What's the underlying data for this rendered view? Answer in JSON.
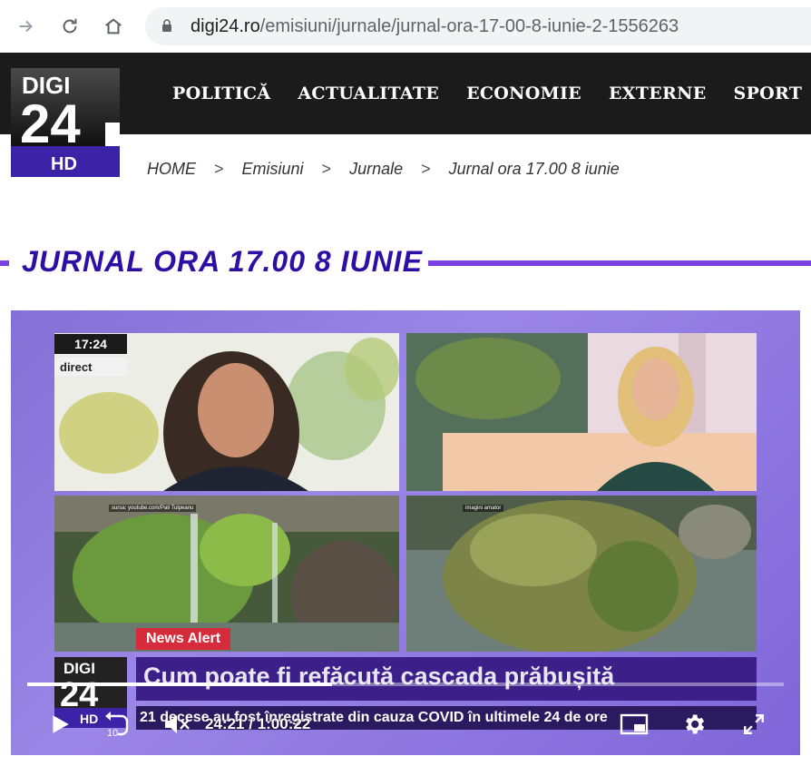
{
  "browser": {
    "url_domain": "digi24.ro",
    "url_path": "/emisiuni/jurnale/jurnal-ora-17-00-8-iunie-2-1556263"
  },
  "site": {
    "logo_top": "DIGI",
    "logo_num": "24",
    "logo_badge": "HD",
    "nav": [
      "POLITICĂ",
      "ACTUALITATE",
      "ECONOMIE",
      "EXTERNE",
      "SPORT"
    ]
  },
  "breadcrumb": {
    "items": [
      "HOME",
      "Emisiuni",
      "Jurnale",
      "Jurnal ora 17.00 8 iunie"
    ],
    "separator": ">"
  },
  "page_title": "JURNAL ORA 17.00 8 IUNIE",
  "video": {
    "clock": "17:24",
    "live_label": "direct",
    "source_1": "sursa: youtube.com/Pali Tulpeanu",
    "source_2": "imagini amator",
    "news_alert": "News Alert",
    "headline": "Cum poate fi refăcută cascada prăbușită",
    "ticker": "21 decese au fost înregistrate din cauza COVID în ultimele 24 de ore",
    "logo_top": "DIGI",
    "logo_num": "24",
    "logo_badge": "HD",
    "current_time": "24:21",
    "time_sep": "/",
    "duration": "1:00:22",
    "progress": 0.403,
    "skip_seconds": "10"
  },
  "colors": {
    "header_bg": "#1b1b1b",
    "title": "#2d0fa5",
    "accent_bar": "#7b3fe4",
    "news_alert": "#d52b3a"
  }
}
